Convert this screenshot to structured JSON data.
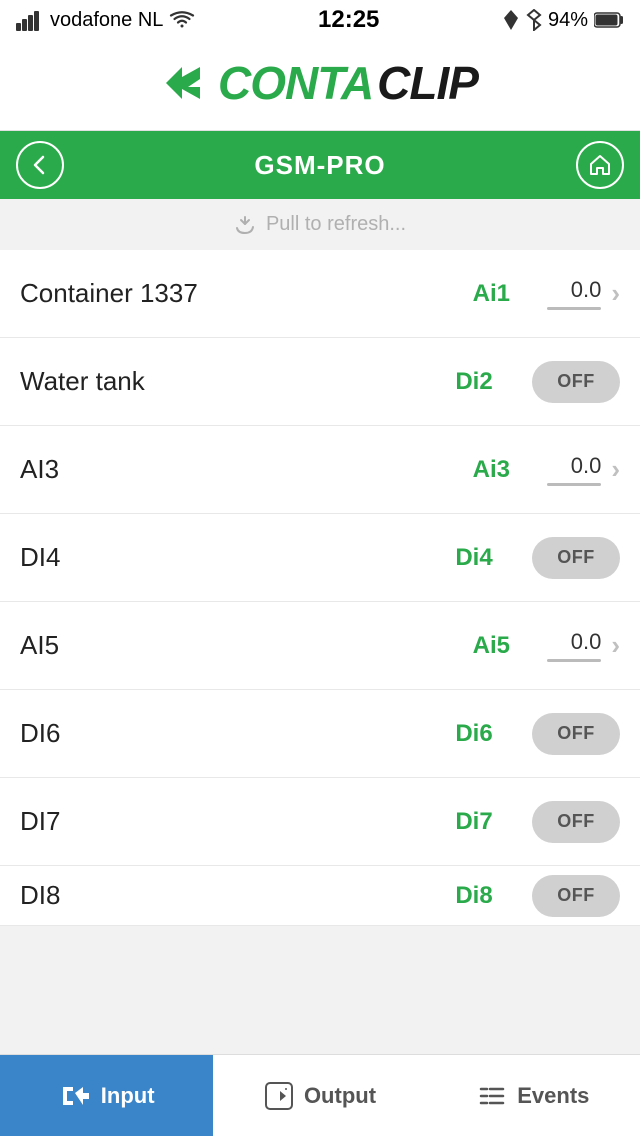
{
  "statusBar": {
    "carrier": "vodafone NL",
    "time": "12:25",
    "battery": "94%"
  },
  "logo": {
    "conta": "CONTA",
    "clip": "CLIP"
  },
  "nav": {
    "title": "GSM-PRO",
    "backLabel": "back",
    "homeLabel": "home"
  },
  "pullRefresh": {
    "text": "Pull to refresh..."
  },
  "listItems": [
    {
      "id": 1,
      "name": "Container 1337",
      "label": "Ai1",
      "type": "analog",
      "value": "0.0"
    },
    {
      "id": 2,
      "name": "Water tank",
      "label": "Di2",
      "type": "digital",
      "value": "OFF"
    },
    {
      "id": 3,
      "name": "AI3",
      "label": "Ai3",
      "type": "analog",
      "value": "0.0"
    },
    {
      "id": 4,
      "name": "DI4",
      "label": "Di4",
      "type": "digital",
      "value": "OFF"
    },
    {
      "id": 5,
      "name": "AI5",
      "label": "Ai5",
      "type": "analog",
      "value": "0.0"
    },
    {
      "id": 6,
      "name": "DI6",
      "label": "Di6",
      "type": "digital",
      "value": "OFF"
    },
    {
      "id": 7,
      "name": "DI7",
      "label": "Di7",
      "type": "digital",
      "value": "OFF"
    },
    {
      "id": 8,
      "name": "DI8",
      "label": "Di8",
      "type": "digital",
      "value": "OFF"
    }
  ],
  "tabs": [
    {
      "id": "input",
      "label": "Input",
      "icon": "input-icon",
      "active": true
    },
    {
      "id": "output",
      "label": "Output",
      "icon": "output-icon",
      "active": false
    },
    {
      "id": "events",
      "label": "Events",
      "icon": "events-icon",
      "active": false
    }
  ],
  "colors": {
    "green": "#2aaa4a",
    "blue": "#3a85c9"
  }
}
